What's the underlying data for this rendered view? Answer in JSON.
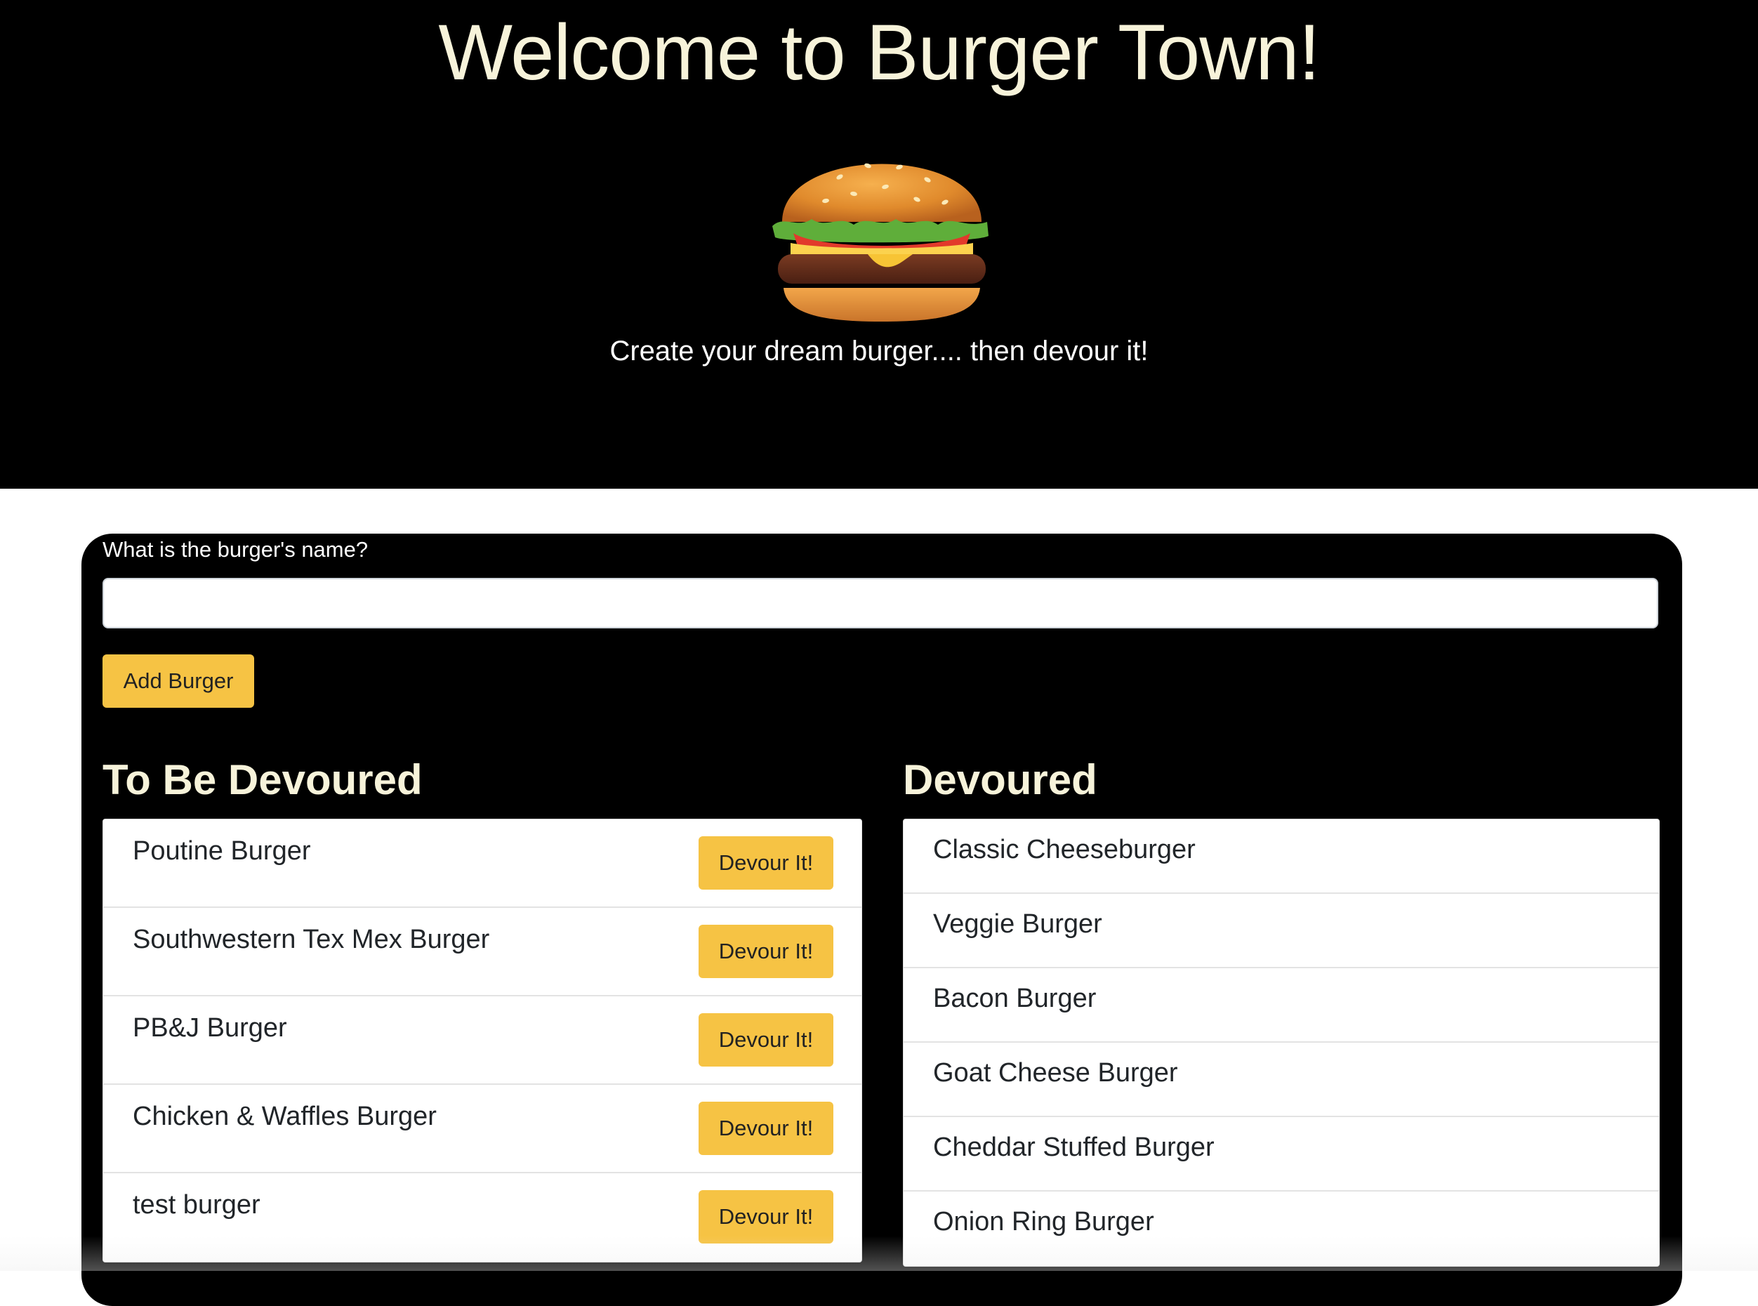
{
  "header": {
    "title": "Welcome to Burger Town!",
    "tagline": "Create your dream burger.... then devour it!",
    "logo_icon": "hamburger-emoji"
  },
  "form": {
    "label": "What is the burger's name?",
    "input_value": "",
    "add_button_label": "Add Burger"
  },
  "to_be_devoured": {
    "heading": "To Be Devoured",
    "button_label": "Devour It!",
    "items": [
      "Poutine Burger",
      "Southwestern Tex Mex Burger",
      "PB&J Burger",
      "Chicken & Waffles Burger",
      "test burger"
    ]
  },
  "devoured": {
    "heading": "Devoured",
    "items": [
      "Classic Cheeseburger",
      "Veggie Burger",
      "Bacon Burger",
      "Goat Cheese Burger",
      "Cheddar Stuffed Burger",
      "Onion Ring Burger"
    ]
  },
  "colors": {
    "background_dark": "#000000",
    "heading_cream": "#f7f3da",
    "button_yellow": "#f6c344"
  }
}
